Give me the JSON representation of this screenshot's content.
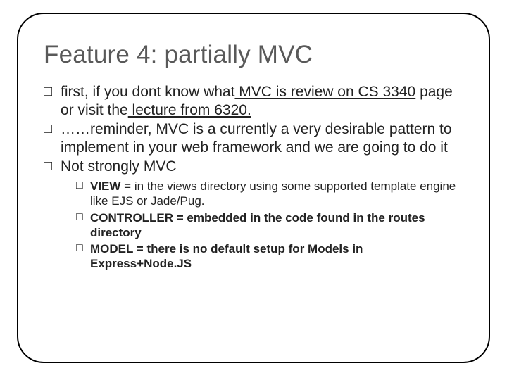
{
  "title": "Feature 4: partially MVC",
  "bullets": {
    "b1_pre": "first, if you dont know what",
    "b1_link1": " MVC is review on CS 3340",
    "b1_mid": " page or visit the",
    "b1_link2": " lecture from 6320.",
    "b2": "……reminder, MVC is a currently a very desirable pattern to implement in your web framework and we are going to do it",
    "b3": "Not strongly MVC"
  },
  "sub": {
    "s1_pre": "VIEW",
    "s1_rest": " = in the views directory using some supported template engine like EJS or Jade/Pug.",
    "s2": "CONTROLLER = embedded in the code found in the routes directory",
    "s3": "MODEL = there is no default setup for Models in Express+Node.JS"
  }
}
